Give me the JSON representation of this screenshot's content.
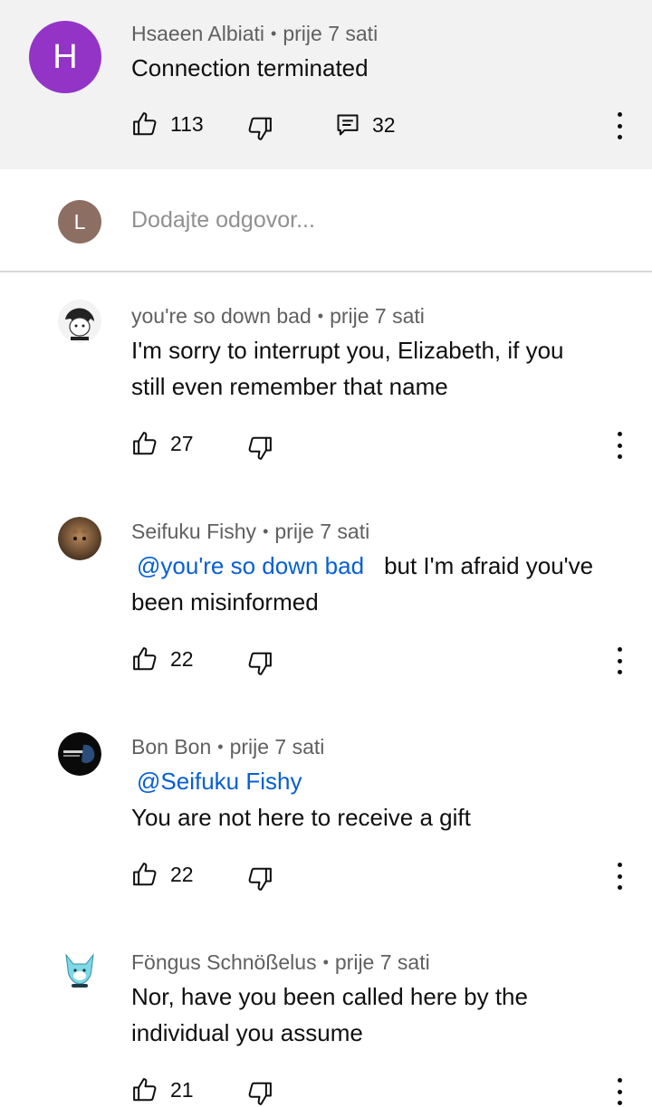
{
  "top_comment": {
    "avatar_letter": "H",
    "avatar_color": "#9334c6",
    "author": "Hsaeen Albiati",
    "separator": "•",
    "time": "prije 7 sati",
    "text": "Connection terminated",
    "likes": "113",
    "replies": "32"
  },
  "reply_box": {
    "avatar_letter": "L",
    "avatar_color": "#8d6e63",
    "placeholder": "Dodajte odgovor..."
  },
  "replies": [
    {
      "author": "you're so down bad",
      "separator": "•",
      "time": "prije 7 sati",
      "line1": "I'm sorry to interrupt you, Elizabeth, if you",
      "line2": "still even remember that name",
      "likes": "27"
    },
    {
      "author": "Seifuku Fishy",
      "separator": "•",
      "time": "prije 7 sati",
      "mention": "@you're so down bad",
      "line1_rest": "but I'm afraid you've",
      "line2": "been misinformed",
      "likes": "22"
    },
    {
      "author": "Bon Bon",
      "separator": "•",
      "time": "prije 7 sati",
      "mention": "@Seifuku Fishy",
      "line2": "You are not here to receive a gift",
      "likes": "22"
    },
    {
      "author": "Föngus Schnößelus",
      "separator": "•",
      "time": "prije 7 sati",
      "line1": "Nor, have you been called here by the",
      "line2": "individual you assume",
      "likes": "21"
    }
  ]
}
